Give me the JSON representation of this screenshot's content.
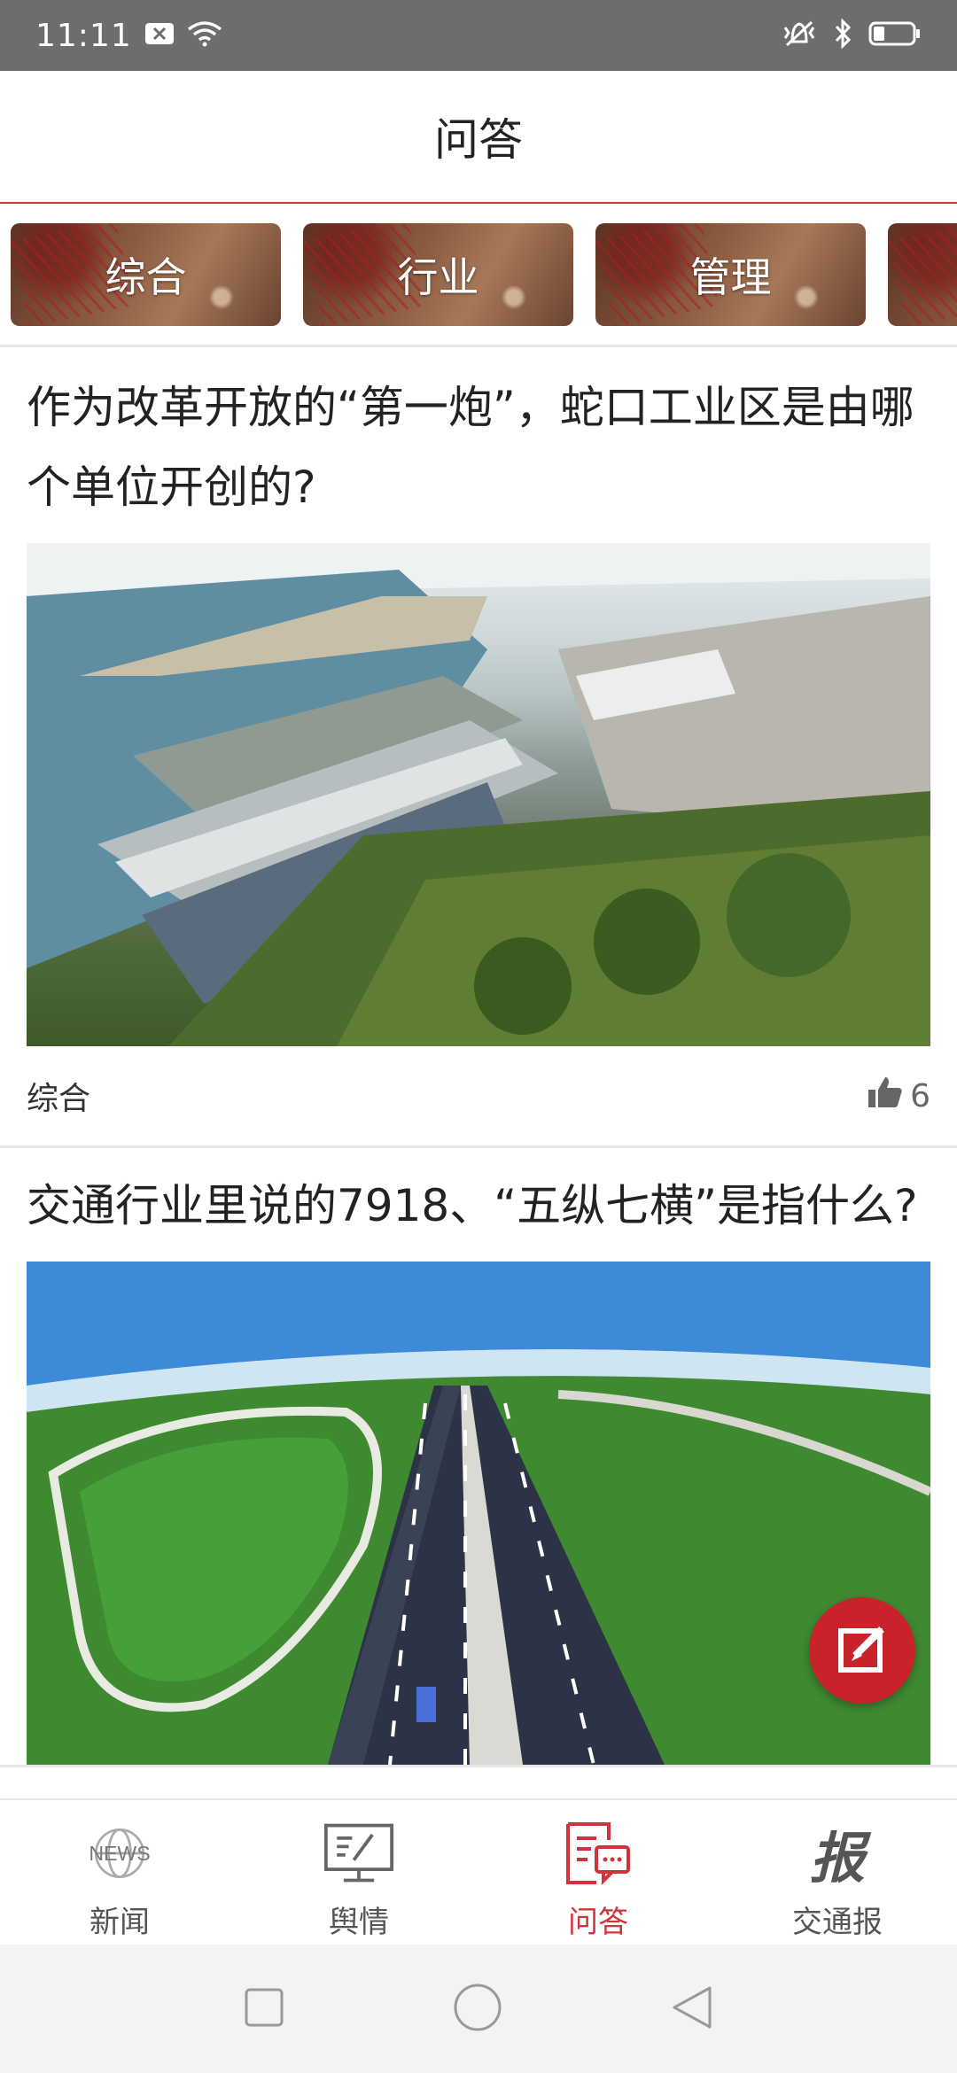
{
  "status_bar": {
    "time": "11:11"
  },
  "header": {
    "title": "问答"
  },
  "categories": [
    {
      "label": "综合"
    },
    {
      "label": "行业"
    },
    {
      "label": "管理"
    },
    {
      "label": ""
    }
  ],
  "feed": [
    {
      "title": "作为改革开放的“第一炮”，蛇口工业区是由哪个单位开创的?",
      "image": "harbor-industrial-zone-aerial-photo",
      "category": "综合",
      "likes": "6"
    },
    {
      "title": "交通行业里说的7918、“五纵七横”是指什么?",
      "image": "highway-interchange-aerial-photo"
    }
  ],
  "bottom_nav": [
    {
      "label": "新闻",
      "icon": "news-icon",
      "active": false
    },
    {
      "label": "舆情",
      "icon": "monitor-icon",
      "active": false
    },
    {
      "label": "问答",
      "icon": "qa-chat-icon",
      "active": true
    },
    {
      "label": "交通报",
      "icon": "newspaper-bao-icon",
      "active": false
    }
  ],
  "icon_glyphs": {
    "news": "NEWS",
    "bao": "报"
  },
  "colors": {
    "accent": "#d0343a",
    "fab": "#c8222a",
    "status_bar": "#6d6d6d"
  }
}
